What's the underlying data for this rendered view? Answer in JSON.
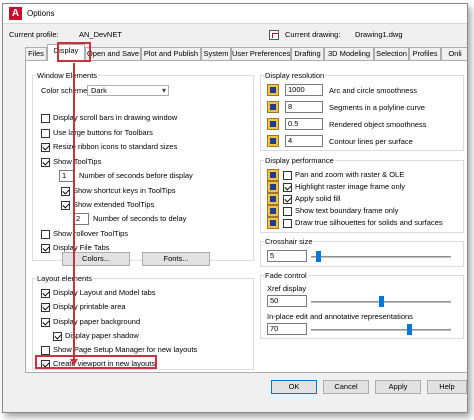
{
  "window": {
    "title": "Options",
    "app_icon": "autocad-icon"
  },
  "profile": {
    "current_profile_label": "Current profile:",
    "current_profile_value": "AN_DevNET",
    "current_drawing_label": "Current drawing:",
    "current_drawing_value": "Drawing1.dwg"
  },
  "tabs": [
    "Files",
    "Display",
    "Open and Save",
    "Plot and Publish",
    "System",
    "User Preferences",
    "Drafting",
    "3D Modeling",
    "Selection",
    "Profiles",
    "Onli"
  ],
  "active_tab": "Display",
  "window_elements": {
    "title": "Window Elements",
    "color_scheme_label": "Color scheme:",
    "color_scheme_value": "Dark",
    "scroll_bars": "Display scroll bars in drawing window",
    "large_buttons": "Use large buttons for Toolbars",
    "resize_ribbon": "Resize ribbon icons to standard sizes",
    "show_tooltips": "Show ToolTips",
    "tooltip_delay_value": "1",
    "tooltip_delay_label": "Number of seconds before display",
    "shortcut_keys": "Show shortcut keys in ToolTips",
    "extended_tooltips": "Show extended ToolTips",
    "extended_delay_value": "2",
    "extended_delay_label": "Number of seconds to delay",
    "rollover_tooltips": "Show rollover ToolTips",
    "file_tabs": "Display File Tabs",
    "colors_button": "Colors...",
    "fonts_button": "Fonts..."
  },
  "layout_elements": {
    "title": "Layout elements",
    "layout_model_tabs": "Display Layout and Model tabs",
    "printable_area": "Display printable area",
    "paper_background": "Display paper background",
    "paper_shadow": "Display paper shadow",
    "page_setup_manager": "Show Page Setup Manager for new layouts",
    "create_viewport": "Create viewport in new layouts"
  },
  "display_resolution": {
    "title": "Display resolution",
    "items": [
      {
        "value": "1000",
        "label": "Arc and circle smoothness"
      },
      {
        "value": "8",
        "label": "Segments in a polyline curve"
      },
      {
        "value": "0.5",
        "label": "Rendered object smoothness"
      },
      {
        "value": "4",
        "label": "Contour lines per surface"
      }
    ]
  },
  "display_performance": {
    "title": "Display performance",
    "items": [
      "Pan and zoom with raster & OLE",
      "Highlight raster image frame only",
      "Apply solid fill",
      "Show text boundary frame only",
      "Draw true silhouettes for solids and surfaces"
    ]
  },
  "crosshair": {
    "title": "Crosshair size",
    "value": "5",
    "fraction": 0.05
  },
  "fade_control": {
    "title": "Fade control",
    "xref_label": "Xref display",
    "xref_value": "50",
    "xref_fraction": 0.5,
    "inplace_label": "In-place edit and annotative representations",
    "inplace_value": "70",
    "inplace_fraction": 0.7
  },
  "footer": {
    "ok": "OK",
    "cancel": "Cancel",
    "apply": "Apply",
    "help": "Help"
  },
  "colors": {
    "annotation_red": "#c8323c",
    "accent_blue": "#0078d7"
  }
}
